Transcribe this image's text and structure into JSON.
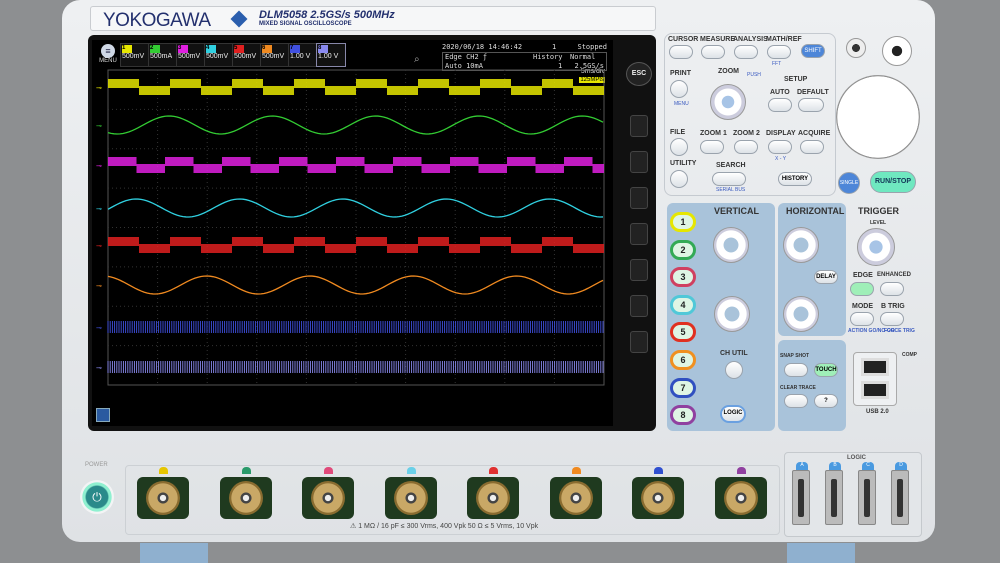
{
  "brand": {
    "logo": "YOKOGAWA",
    "model": "DLM5058  2.5GS/s 500MHz",
    "subtitle": "MIXED SIGNAL OSCILLOSCOPE"
  },
  "screen": {
    "menu": "MENU",
    "channels": [
      {
        "n": "1",
        "scale": "500mV",
        "color": "#e6e600"
      },
      {
        "n": "2",
        "scale": "500mA",
        "color": "#33cc33"
      },
      {
        "n": "3",
        "scale": "500mV",
        "color": "#e020e0"
      },
      {
        "n": "4",
        "scale": "500mV",
        "color": "#30d0e0"
      },
      {
        "n": "5",
        "scale": "500mV",
        "color": "#e02020"
      },
      {
        "n": "6",
        "scale": "500mV",
        "color": "#f08a20"
      },
      {
        "n": "7",
        "scale": "1.00 V",
        "color": "#4050e0"
      },
      {
        "n": "8",
        "scale": "1.00 V",
        "color": "#8a8af0"
      }
    ],
    "datetime": "2020/06/18 14:46:42",
    "count": "1",
    "state": "Stopped",
    "trigger": "Edge CH2 ƒ",
    "trigger_mode": "Auto 10mA",
    "history_label": "History",
    "history_value": "1",
    "acq_mode": "Normal",
    "sample_rate": "2.5GS/s",
    "timebase": "5ms/div",
    "record": "125MPts"
  },
  "softkeys": {
    "esc": "ESC"
  },
  "panel": {
    "cursor": "CURSOR",
    "measure": "MEASURE",
    "analysis": "ANALYSIS",
    "mathref": "MATH/REF",
    "fft": "FFT",
    "shift": "SHIFT",
    "print": "PRINT",
    "menu": "MENU",
    "zoom": "ZOOM",
    "push": "PUSH",
    "setup": "SETUP",
    "auto": "AUTO",
    "default": "DEFAULT",
    "file": "FILE",
    "zoom1": "ZOOM 1",
    "zoom2": "ZOOM 2",
    "display": "DISPLAY",
    "xy": "X - Y",
    "acquire": "ACQUIRE",
    "utility": "UTILITY",
    "search": "SEARCH",
    "serial_bus": "SERIAL BUS",
    "history": "HISTORY",
    "single": "SINGLE",
    "runstop": "RUN/STOP",
    "vertical": "VERTICAL",
    "horizontal": "HORIZONTAL",
    "trigger": "TRIGGER",
    "level": "LEVEL",
    "delay": "DELAY",
    "edge": "EDGE",
    "enhanced": "ENHANCED",
    "mode": "MODE",
    "btrig": "B TRIG",
    "action": "ACTION GO/NO-GO",
    "force": "FORCE TRIG",
    "chutil": "CH UTIL",
    "logic": "LOGIC",
    "snapshot": "SNAP SHOT",
    "touch": "TOUCH",
    "clear_trace": "CLEAR TRACE",
    "help": "?",
    "usb": "USB 2.0",
    "comp": "COMP",
    "channel_buttons": [
      "1",
      "2",
      "3",
      "4",
      "5",
      "6",
      "7",
      "8"
    ]
  },
  "front": {
    "power": "POWER",
    "spec": "⚠ 1 MΩ / 16 pF ≤ 300 Vrms, 400 Vpk   50 Ω ≤ 5 Vrms, 10 Vpk",
    "logic": "LOGIC",
    "logic_ports": [
      "A",
      "B",
      "C",
      "D"
    ]
  }
}
